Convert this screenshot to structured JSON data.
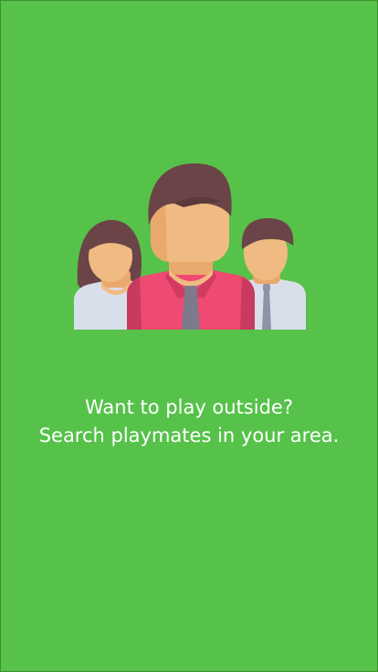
{
  "screen": {
    "background_color": "#56c24a",
    "illustration": {
      "icon": "group-of-people-illustration"
    },
    "message": {
      "line1": "Want to play outside?",
      "line2": "Search playmates in your area."
    }
  }
}
